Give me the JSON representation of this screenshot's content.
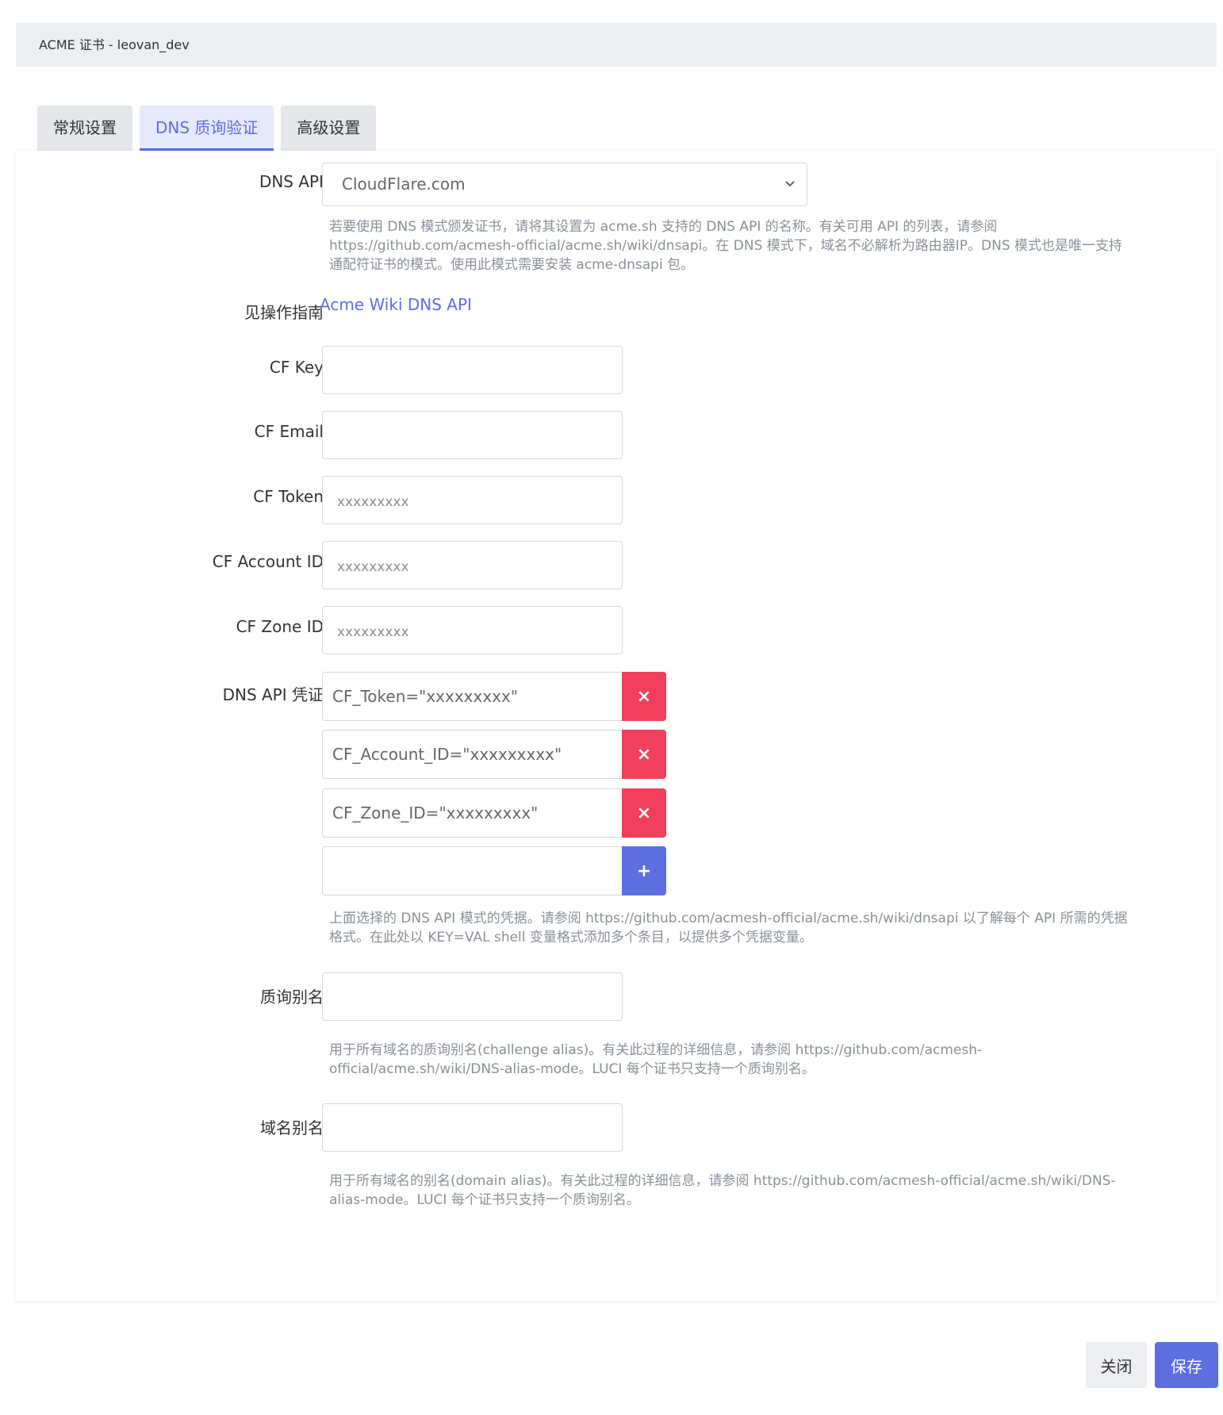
{
  "window": {
    "title": "ACME 证书 - leovan_dev"
  },
  "tabs": [
    {
      "label": "常规设置"
    },
    {
      "label": "DNS 质询验证"
    },
    {
      "label": "高级设置"
    }
  ],
  "form": {
    "dns_api": {
      "label": "DNS API",
      "value": "CloudFlare.com",
      "help_lines": [
        "若要使用 DNS 模式颁发证书，请将其设置为 acme.sh 支持的 DNS API 的名称。有关可用 API 的列表，请参阅",
        "https://github.com/acmesh-official/acme.sh/wiki/dnsapi。在 DNS 模式下，域名不必解析为路由器IP。DNS 模式也是唯一支持",
        "通配符证书的模式。使用此模式需要安装 acme-dnsapi 包。"
      ]
    },
    "guide": {
      "label": "见操作指南",
      "link_text": "Acme Wiki DNS API"
    },
    "cf_key": {
      "label": "CF Key",
      "value": "",
      "placeholder": ""
    },
    "cf_email": {
      "label": "CF Email",
      "value": "",
      "placeholder": ""
    },
    "cf_token": {
      "label": "CF Token",
      "value": "",
      "placeholder": "xxxxxxxxx"
    },
    "cf_account_id": {
      "label": "CF Account ID",
      "value": "",
      "placeholder": "xxxxxxxxx"
    },
    "cf_zone_id": {
      "label": "CF Zone ID",
      "value": "",
      "placeholder": "xxxxxxxxx"
    },
    "credentials": {
      "label": "DNS API 凭证",
      "entries": [
        {
          "value": "CF_Token=\"xxxxxxxxx\""
        },
        {
          "value": "CF_Account_ID=\"xxxxxxxxx\""
        },
        {
          "value": "CF_Zone_ID=\"xxxxxxxxx\""
        }
      ],
      "new_entry": {
        "value": ""
      },
      "remove_label": "×",
      "add_label": "+",
      "help_lines": [
        "上面选择的 DNS API 模式的凭据。请参阅 https://github.com/acmesh-official/acme.sh/wiki/dnsapi 以了解每个 API 所需的凭据",
        "格式。在此处以 KEY=VAL shell 变量格式添加多个条目，以提供多个凭据变量。"
      ]
    },
    "challenge_alias": {
      "label": "质询别名",
      "value": "",
      "help_lines": [
        "用于所有域名的质询别名(challenge alias)。有关此过程的详细信息，请参阅 https://github.com/acmesh-",
        "official/acme.sh/wiki/DNS-alias-mode。LUCI 每个证书只支持一个质询别名。"
      ]
    },
    "domain_alias": {
      "label": "域名别名",
      "value": "",
      "help_lines": [
        "用于所有域名的别名(domain alias)。有关此过程的详细信息，请参阅 https://github.com/acmesh-official/acme.sh/wiki/DNS-",
        "alias-mode。LUCI 每个证书只支持一个质询别名。"
      ]
    }
  },
  "footer": {
    "close_label": "关闭",
    "save_label": "保存"
  },
  "colors": {
    "accent": "#5c6ee0",
    "danger": "#f23f5b",
    "header_bg": "#eceef1"
  }
}
